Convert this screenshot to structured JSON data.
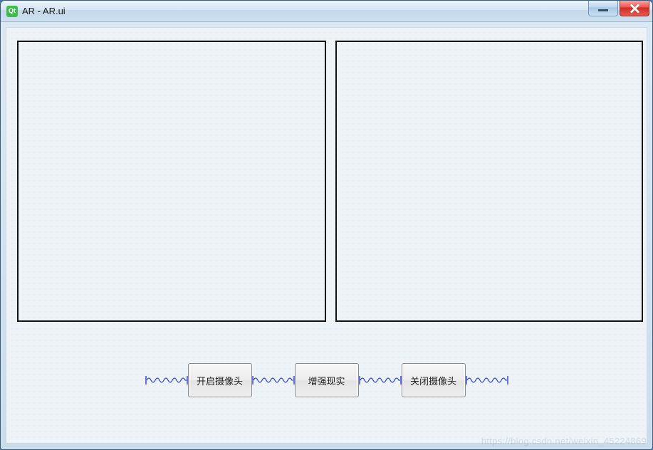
{
  "window": {
    "app_icon_label": "Qt",
    "title": "AR - AR.ui"
  },
  "buttons": {
    "open_camera": "开启摄像头",
    "augmented_reality": "增强现实",
    "close_camera": "关闭摄像头"
  },
  "watermark": "https://blog.csdn.net/weixin_45224869"
}
